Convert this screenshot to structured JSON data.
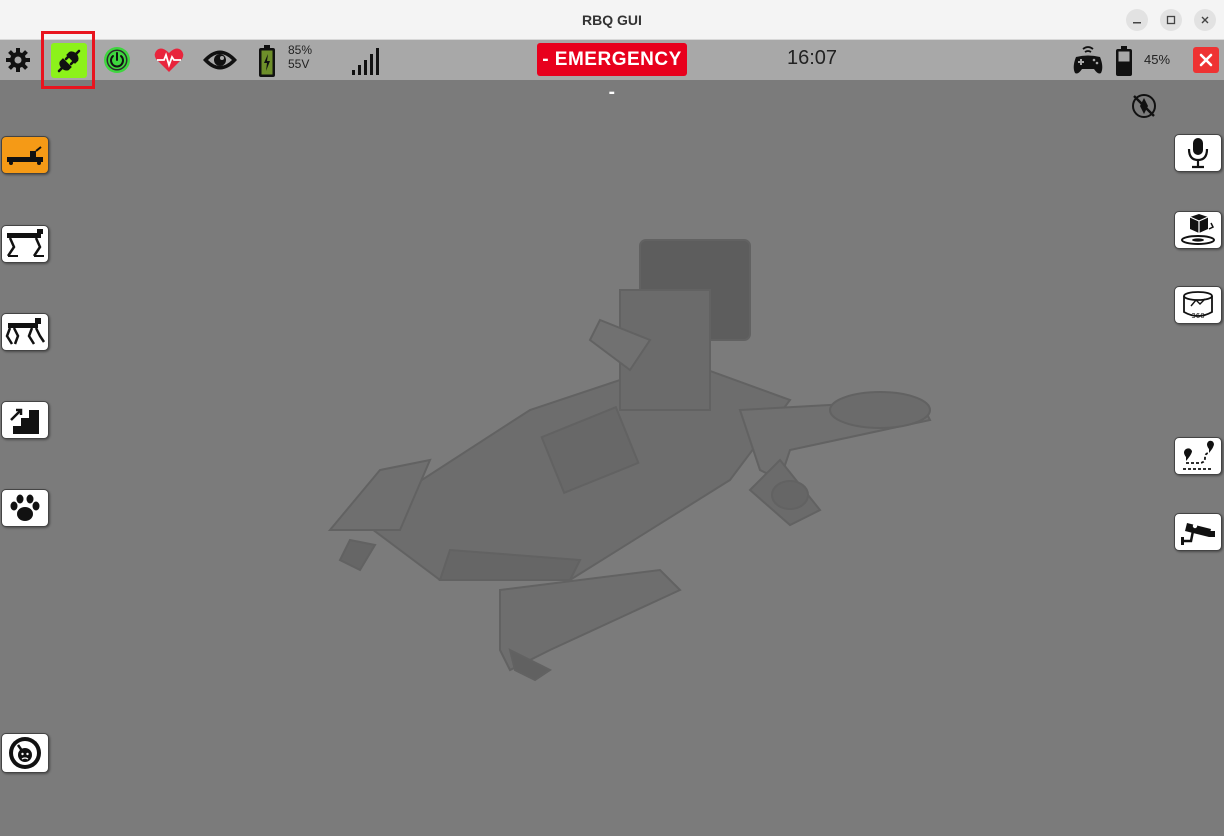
{
  "window": {
    "title": "RBQ GUI"
  },
  "toolbar": {
    "battery_percent": "85%",
    "battery_voltage": "55V",
    "status_label": "- EMERGENCY -",
    "clock": "16:07",
    "controller_battery": "45%"
  },
  "left_panel": {
    "items": [
      {
        "icon": "lie-down-icon",
        "active": true
      },
      {
        "icon": "stand-icon",
        "active": false
      },
      {
        "icon": "walk-icon",
        "active": false
      },
      {
        "icon": "stairs-icon",
        "active": false
      },
      {
        "icon": "paw-icon",
        "active": false
      },
      {
        "icon": "speedometer-icon",
        "active": false
      }
    ]
  },
  "right_panel": {
    "items": [
      {
        "icon": "microphone-icon"
      },
      {
        "icon": "3d-map-icon"
      },
      {
        "icon": "360-camera-icon"
      },
      {
        "icon": "route-path-icon"
      },
      {
        "icon": "cctv-camera-icon"
      }
    ]
  },
  "colors": {
    "emergency": "#e8001d",
    "active_mode": "#f59a16",
    "connection_ok": "#8cf21a",
    "power_ring": "#3ed63e",
    "heart": "#e8243c",
    "close": "#ee3333",
    "highlight_box": "#e8141e"
  }
}
